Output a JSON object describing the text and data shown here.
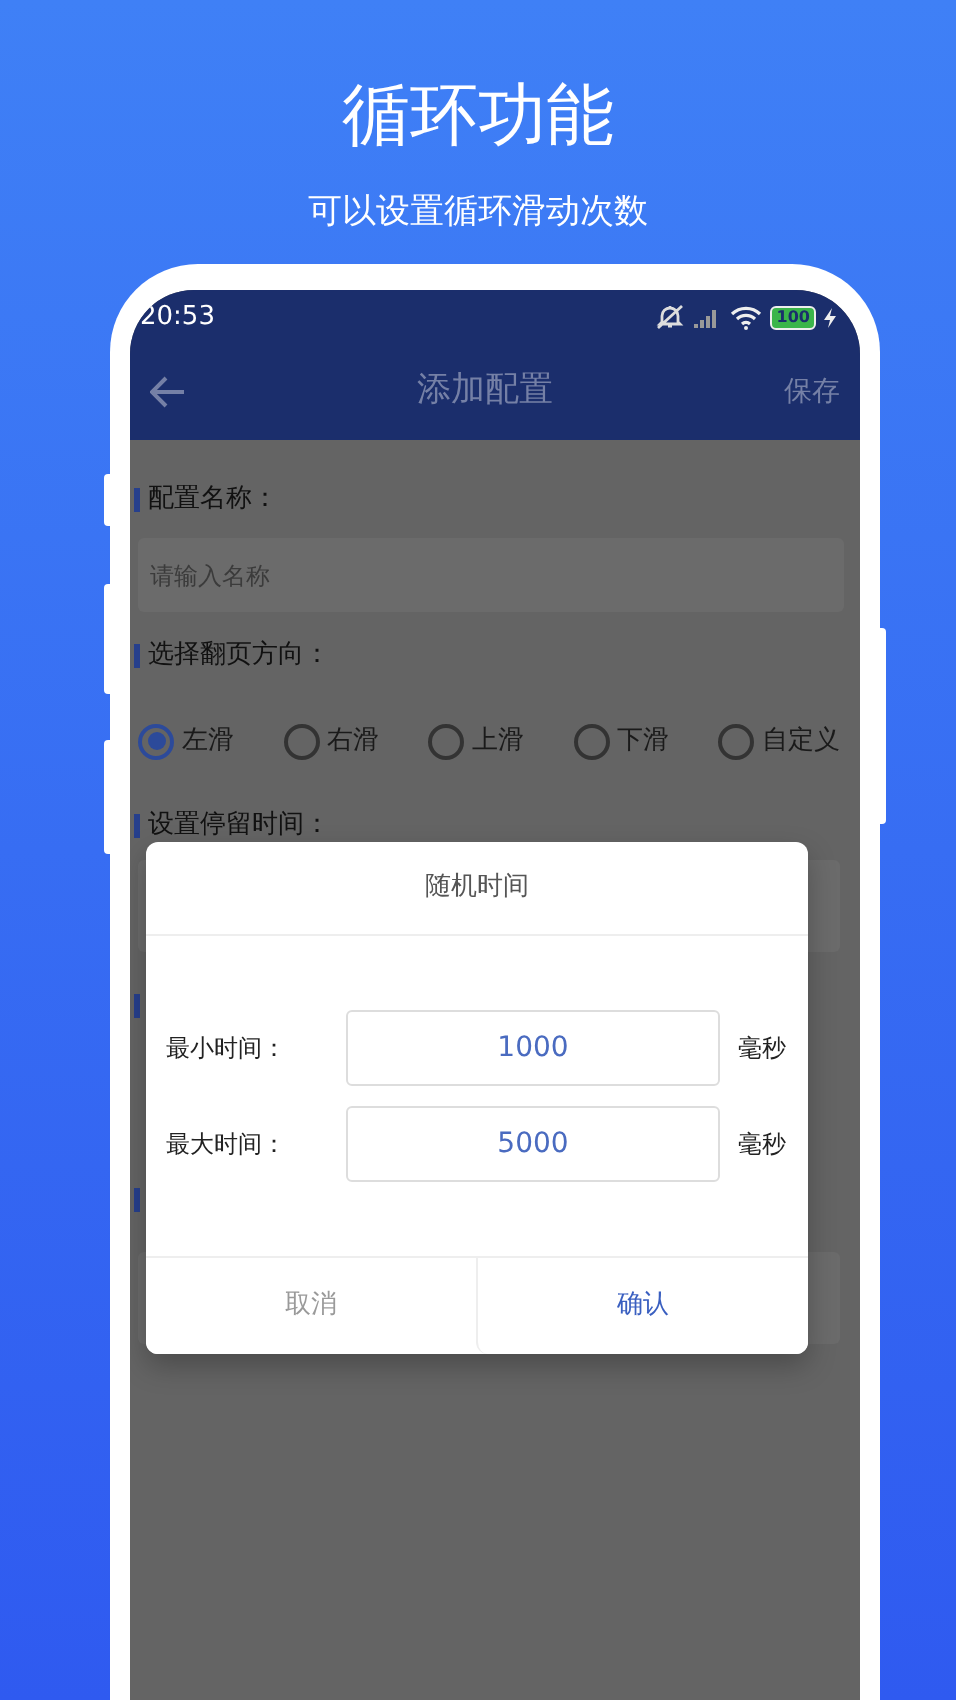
{
  "header": {
    "title": "循环功能",
    "subtitle": "可以设置循环滑动次数"
  },
  "status_bar": {
    "time": "20:53",
    "battery": "100"
  },
  "nav": {
    "title": "添加配置",
    "action": "保存"
  },
  "form": {
    "name_label": "配置名称：",
    "name_placeholder": "请输入名称",
    "direction_label": "选择翻页方向：",
    "directions": [
      {
        "label": "左滑",
        "selected": true
      },
      {
        "label": "右滑",
        "selected": false
      },
      {
        "label": "上滑",
        "selected": false
      },
      {
        "label": "下滑",
        "selected": false
      },
      {
        "label": "自定义",
        "selected": false
      }
    ],
    "stay_label": "设置停留时间："
  },
  "dialog": {
    "title": "随机时间",
    "fields": [
      {
        "label": "最小时间：",
        "value": "1000",
        "unit": "毫秒"
      },
      {
        "label": "最大时间：",
        "value": "5000",
        "unit": "毫秒"
      }
    ],
    "buttons": [
      {
        "label": "取消",
        "kind": "cancel"
      },
      {
        "label": "确认",
        "kind": "confirm"
      }
    ]
  }
}
